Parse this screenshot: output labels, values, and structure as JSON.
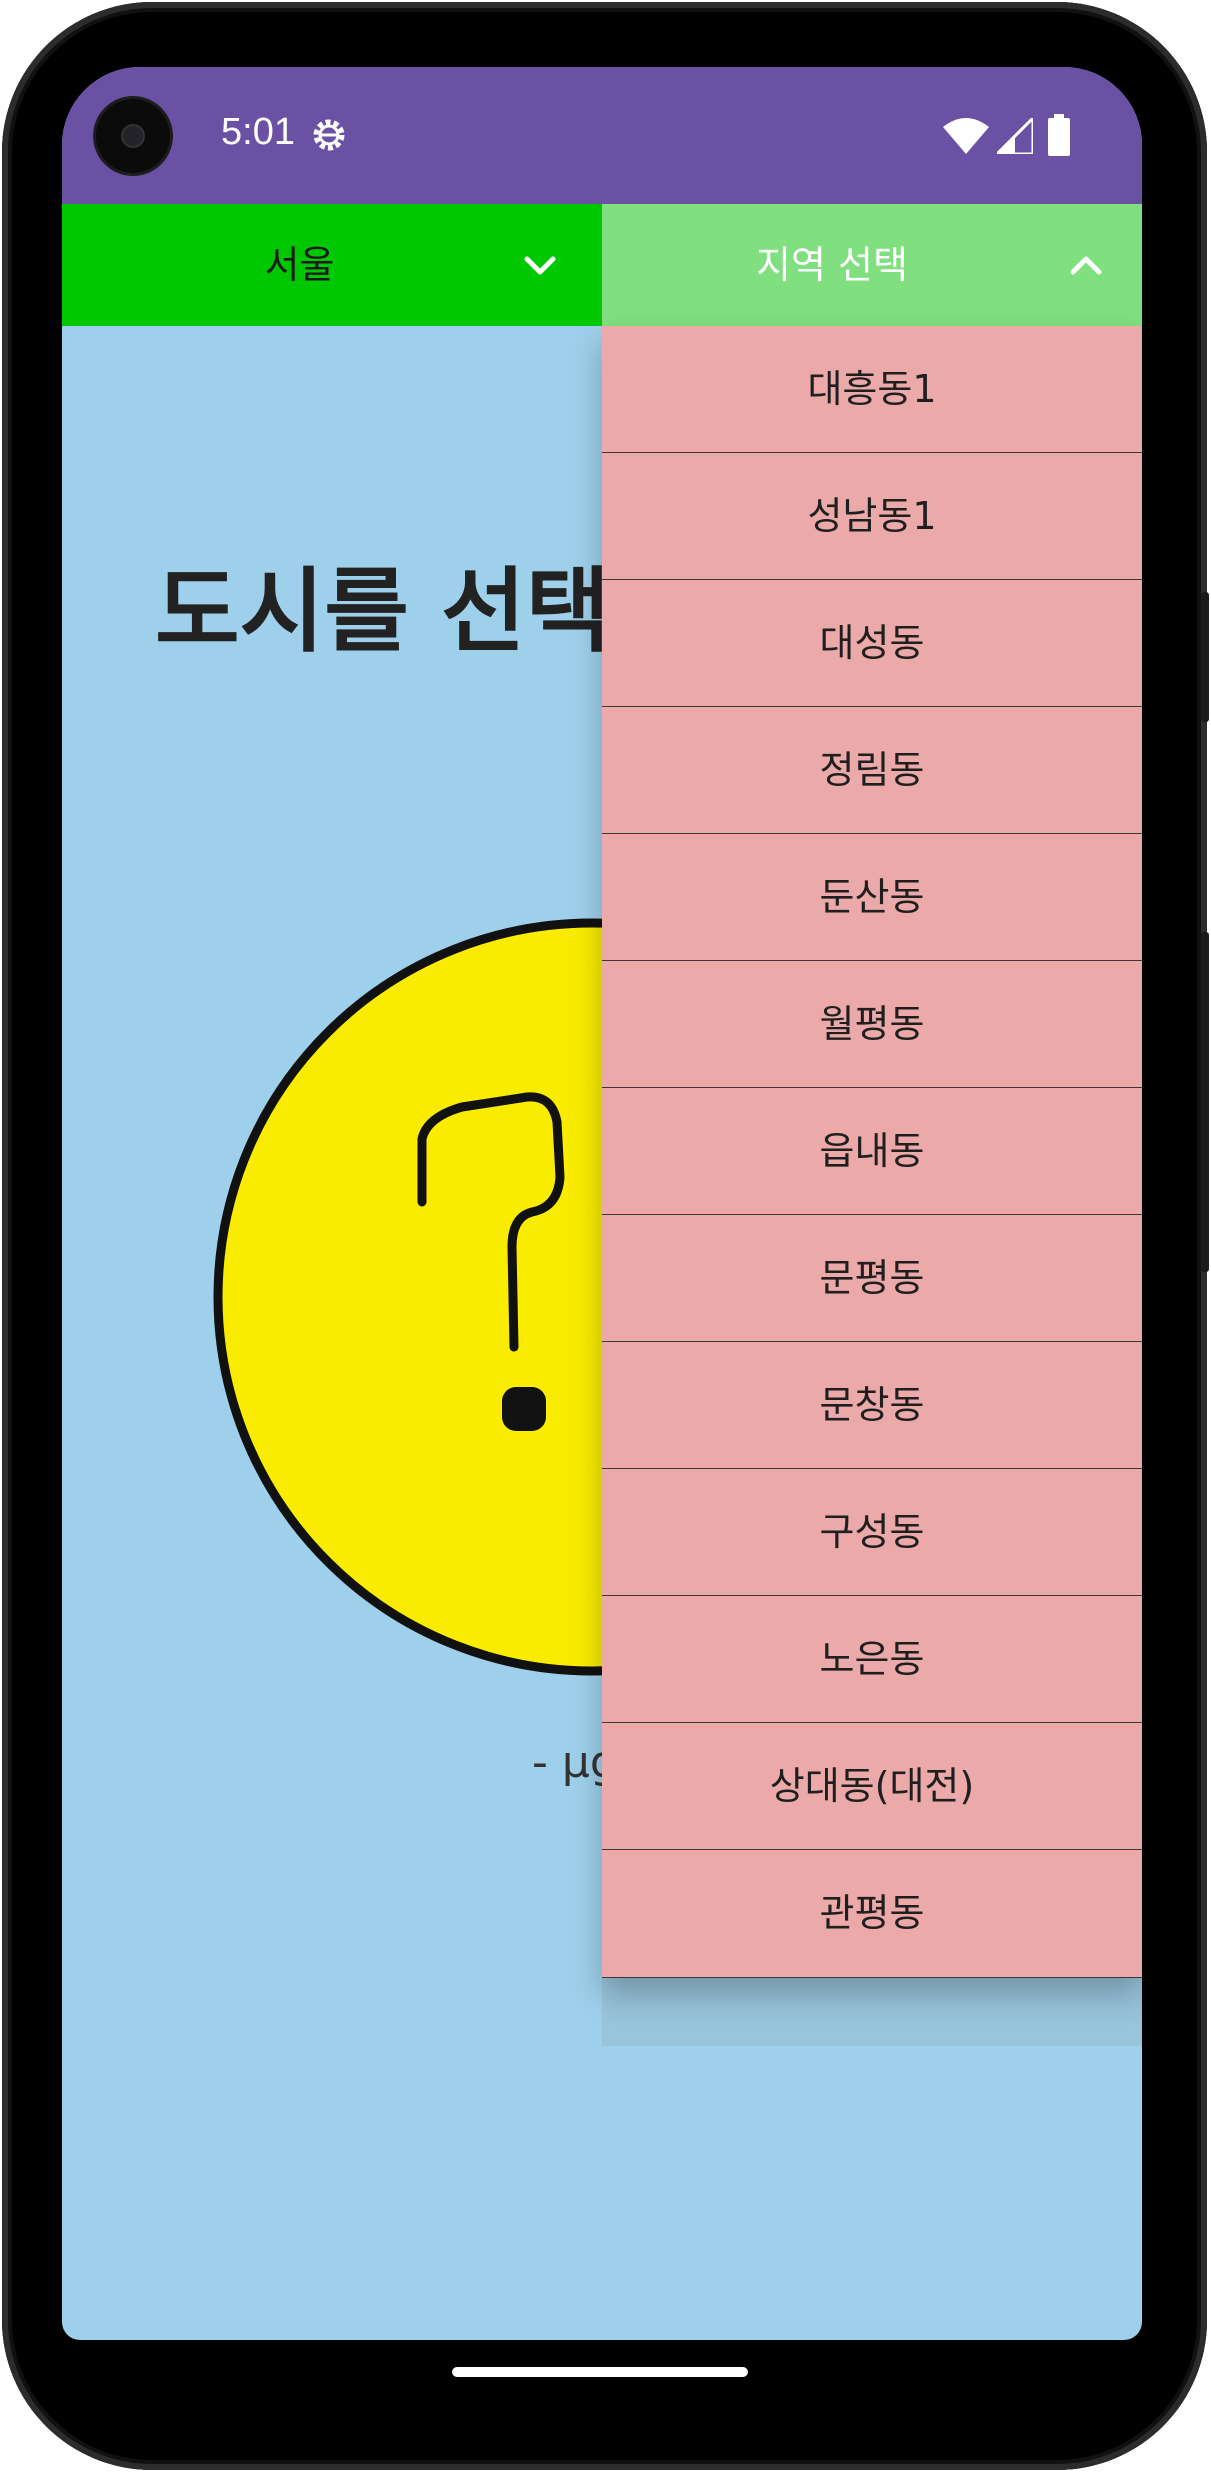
{
  "status_bar": {
    "time": "5:01",
    "icons": [
      "settings-gear-icon",
      "wifi-icon",
      "signal-icon",
      "battery-icon"
    ]
  },
  "city_spinner": {
    "selected": "서울"
  },
  "region_spinner": {
    "selected": "지역 선택",
    "expanded": true,
    "options": [
      "대흥동1",
      "성남동1",
      "대성동",
      "정림동",
      "둔산동",
      "월평동",
      "읍내동",
      "문평동",
      "문창동",
      "구성동",
      "노은동",
      "상대동(대전)",
      "관평동"
    ]
  },
  "main": {
    "title": "도시를 선택",
    "unit_text": "- µg"
  },
  "colors": {
    "status_bar": "#6a51a3",
    "city_spinner": "#00c800",
    "region_spinner": "#80e080",
    "background": "#9fd0eb",
    "dropdown_item": "#eba9aa",
    "face": "#f9ec00"
  }
}
